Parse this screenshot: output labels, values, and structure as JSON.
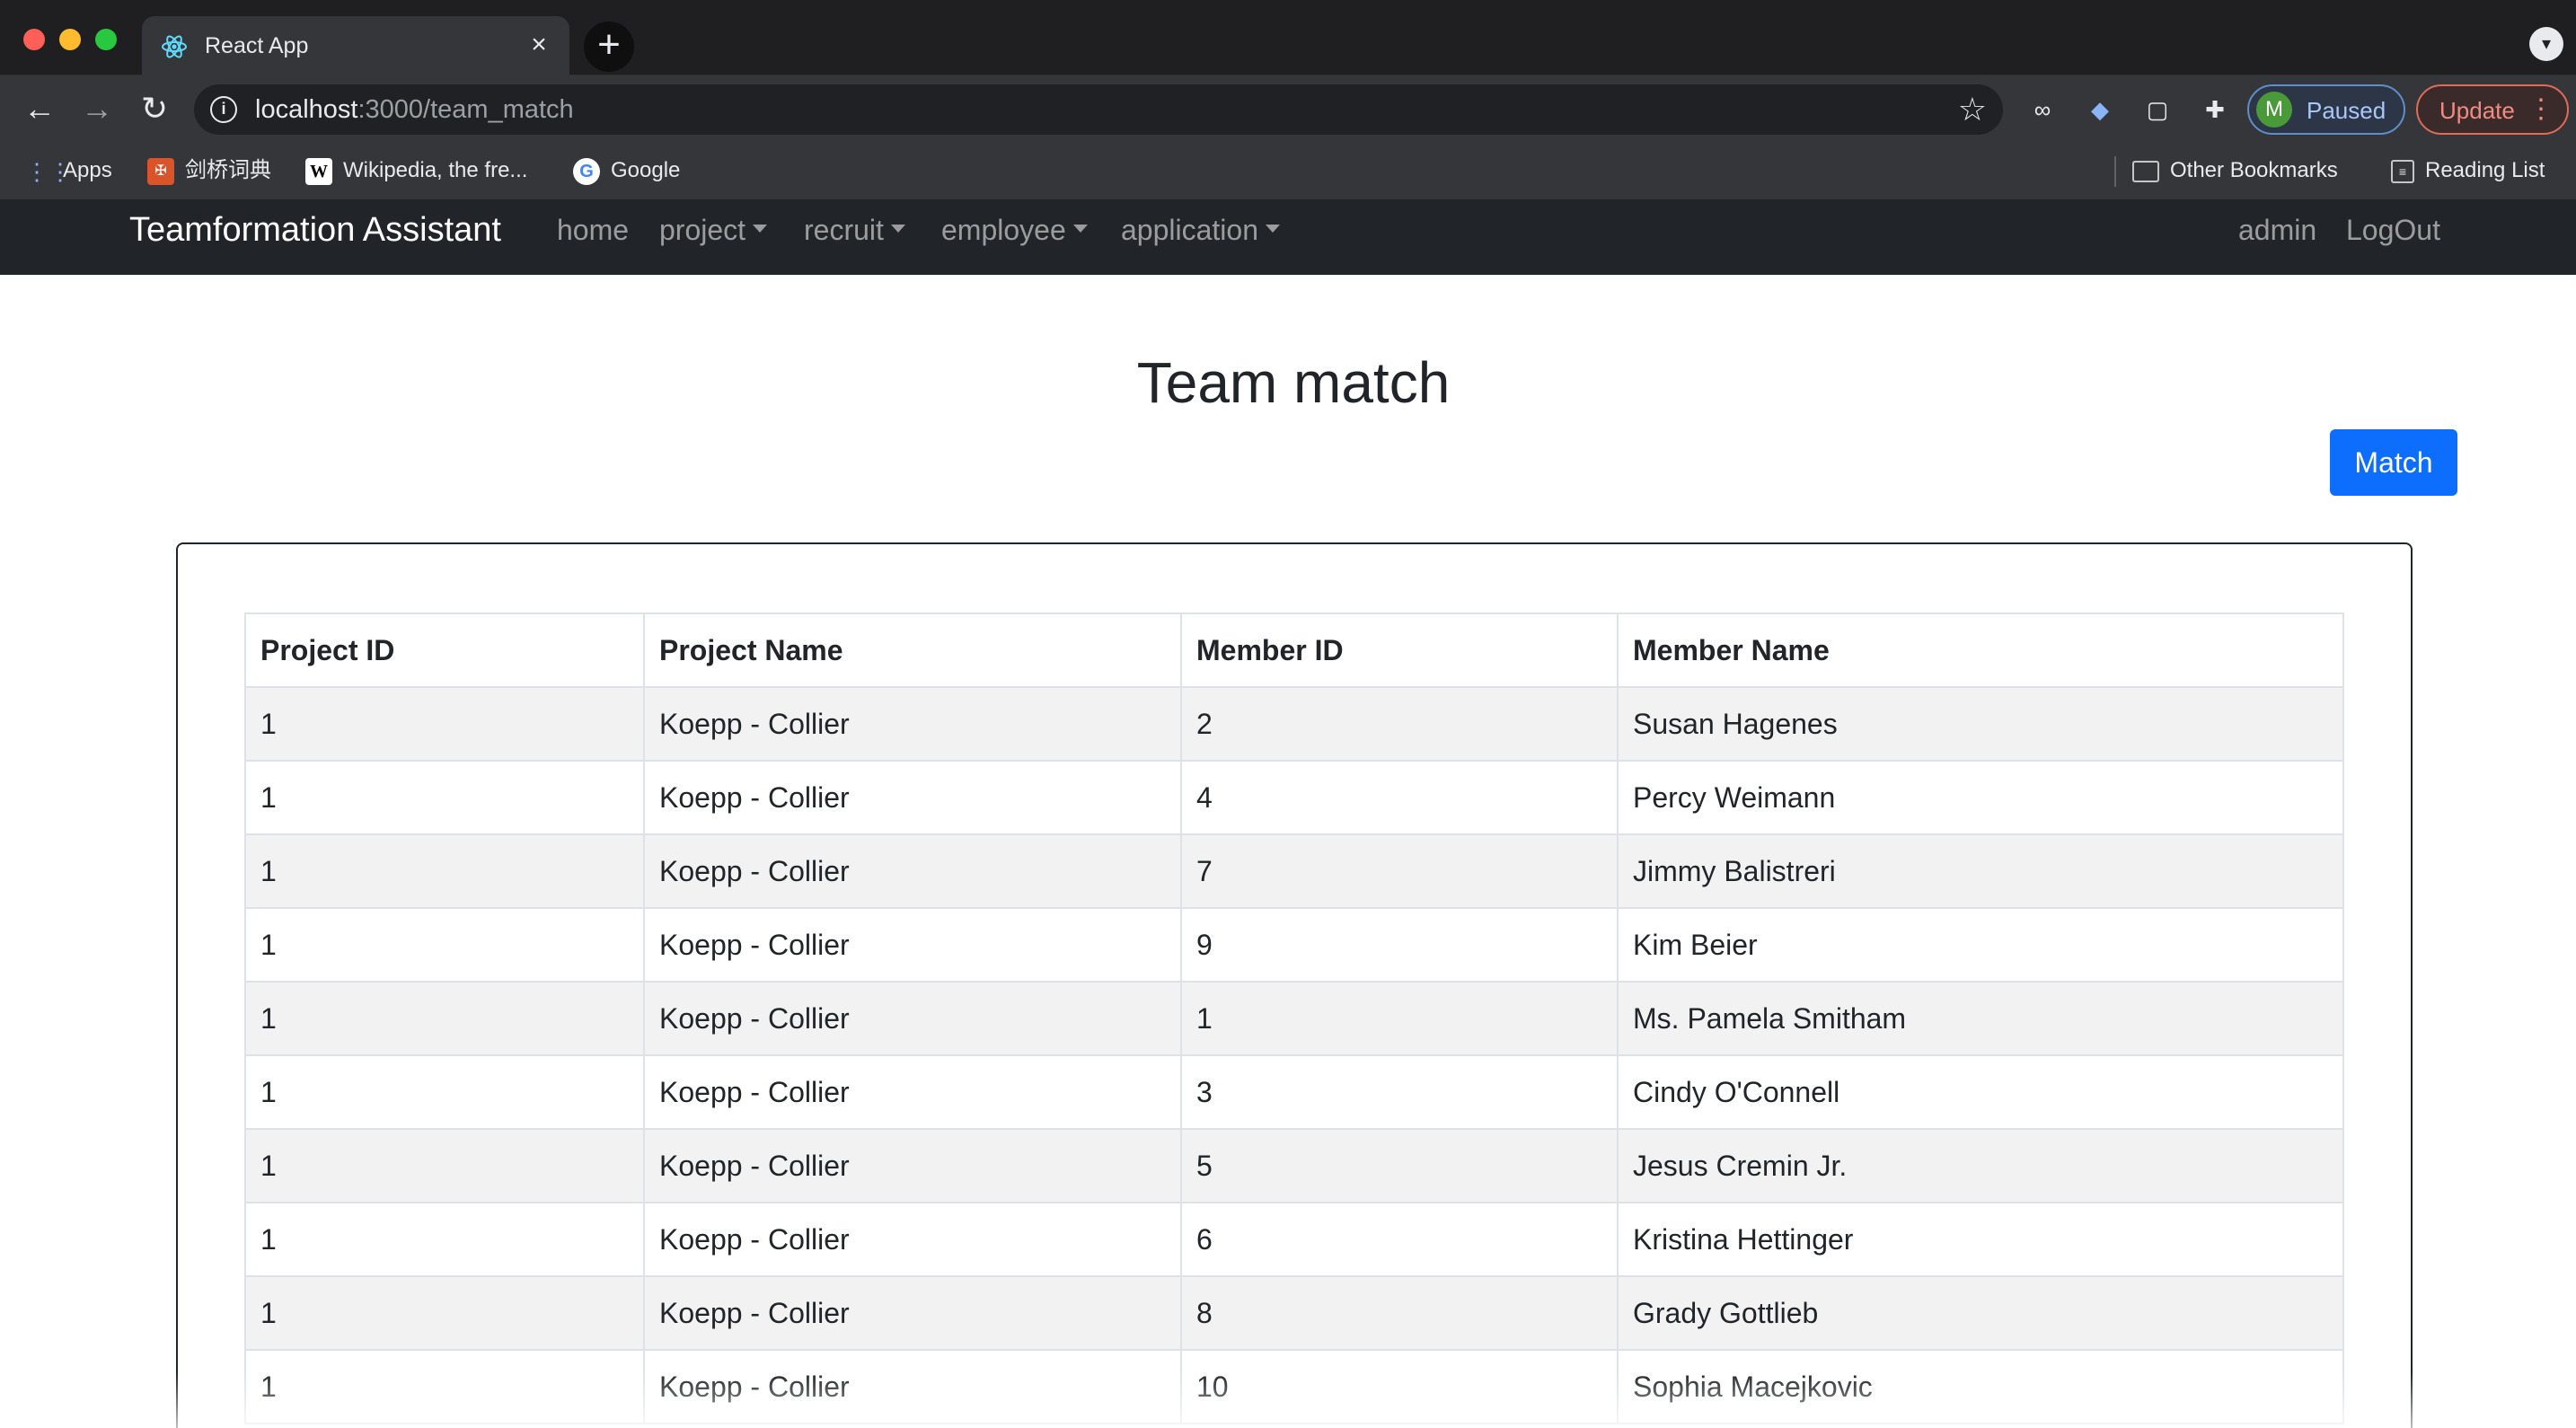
{
  "browser": {
    "tab_title": "React App",
    "url_host": "localhost",
    "url_path": ":3000/team_match",
    "profile_initial": "M",
    "profile_label": "Paused",
    "update_label": "Update",
    "bookmarks": [
      "Apps",
      "剑桥词典",
      "Wikipedia, the fre...",
      "Google"
    ],
    "other_bookmarks": "Other Bookmarks",
    "reading_list": "Reading List"
  },
  "navbar": {
    "brand": "Teamformation Assistant",
    "links": {
      "home": "home",
      "project": "project",
      "recruit": "recruit",
      "employee": "employee",
      "application": "application"
    },
    "user": "admin",
    "logout": "LogOut"
  },
  "page": {
    "title": "Team match",
    "match_button": "Match"
  },
  "table": {
    "headers": [
      "Project ID",
      "Project Name",
      "Member ID",
      "Member Name"
    ],
    "rows": [
      [
        "1",
        "Koepp - Collier",
        "2",
        "Susan Hagenes"
      ],
      [
        "1",
        "Koepp - Collier",
        "4",
        "Percy Weimann"
      ],
      [
        "1",
        "Koepp - Collier",
        "7",
        "Jimmy Balistreri"
      ],
      [
        "1",
        "Koepp - Collier",
        "9",
        "Kim Beier"
      ],
      [
        "1",
        "Koepp - Collier",
        "1",
        "Ms. Pamela Smitham"
      ],
      [
        "1",
        "Koepp - Collier",
        "3",
        "Cindy O'Connell"
      ],
      [
        "1",
        "Koepp - Collier",
        "5",
        "Jesus Cremin Jr."
      ],
      [
        "1",
        "Koepp - Collier",
        "6",
        "Kristina Hettinger"
      ],
      [
        "1",
        "Koepp - Collier",
        "8",
        "Grady Gottlieb"
      ],
      [
        "1",
        "Koepp - Collier",
        "10",
        "Sophia Macejkovic"
      ]
    ]
  },
  "icons": {
    "tab_favicon": "react-icon",
    "close": "close-icon",
    "new_tab": "plus-icon",
    "back": "arrow-left-icon",
    "forward": "arrow-right-icon",
    "reload": "reload-icon",
    "info": "info-icon",
    "star": "star-icon",
    "extensions": "puzzle-icon"
  },
  "colors": {
    "primary": "#0d6efd",
    "navbar_bg": "#212529",
    "chrome_bg": "#35363a"
  }
}
